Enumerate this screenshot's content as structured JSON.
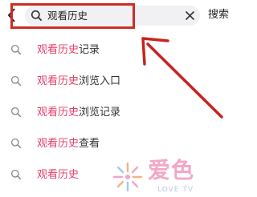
{
  "search": {
    "query": "观看历史",
    "submit_label": "搜索"
  },
  "suggestions": [
    {
      "highlight": "观看历史",
      "rest": "记录"
    },
    {
      "highlight": "观看历史",
      "rest": "浏览入口"
    },
    {
      "highlight": "观看历史",
      "rest": "浏览记录"
    },
    {
      "highlight": "观看历史",
      "rest": "查看"
    },
    {
      "highlight": "观看历史",
      "rest": ""
    }
  ],
  "watermark": {
    "text": "爱色",
    "subtext": "LOVE TV"
  },
  "colors": {
    "highlight_box": "#d12a26",
    "arrow": "#c8231f",
    "match_text": "#e0416c"
  },
  "icons": {
    "back": "chevron-left-icon",
    "search": "search-icon",
    "clear": "close-icon",
    "suggestion": "search-icon"
  }
}
